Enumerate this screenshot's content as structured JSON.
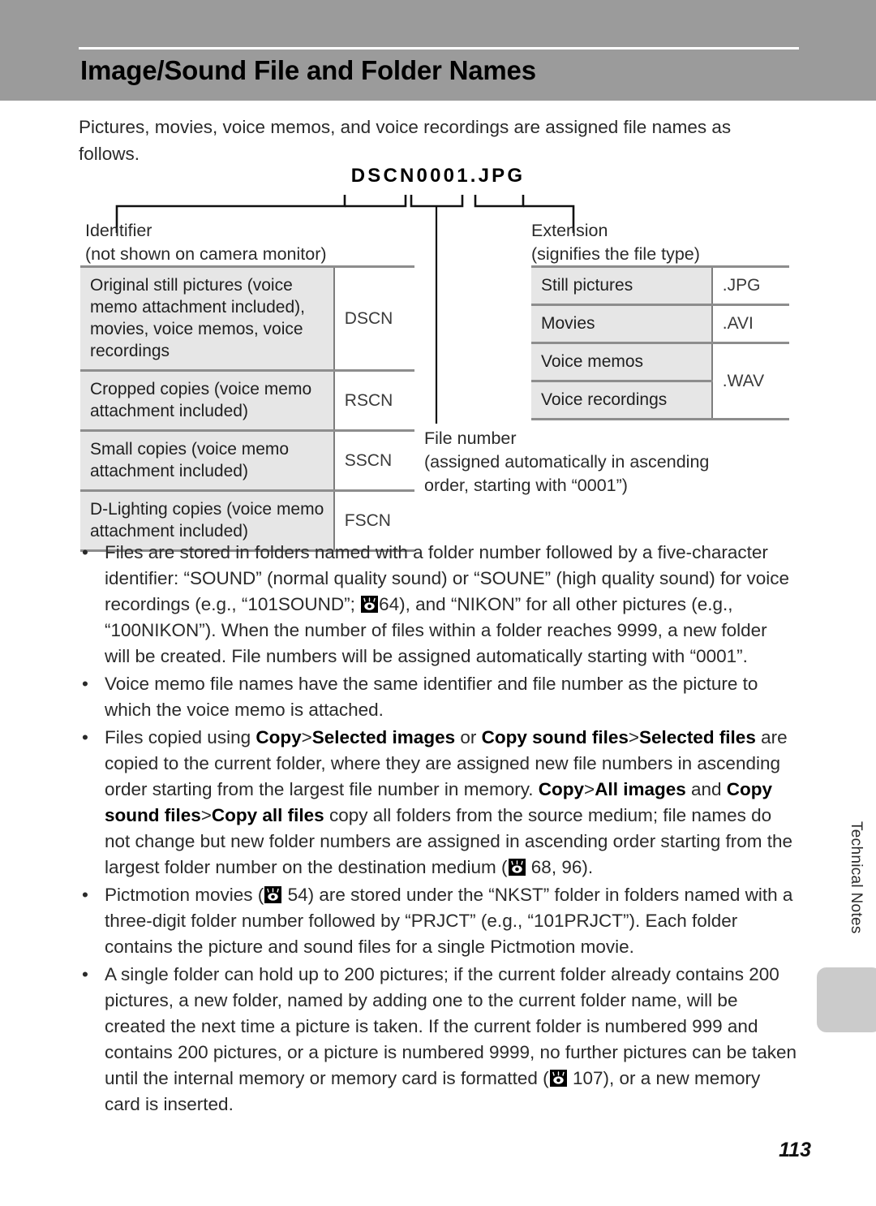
{
  "header": {
    "title": "Image/Sound File and Folder Names"
  },
  "intro": "Pictures, movies, voice memos, and voice recordings are assigned file names as follows.",
  "filename_sample": "DSCN0001.JPG",
  "callouts": {
    "identifier_label": "Identifier",
    "identifier_note": "(not shown on camera monitor)",
    "extension_label": "Extension",
    "extension_note": "(signifies the file type)",
    "filenumber_label": "File number",
    "filenumber_note_line1": "(assigned automatically in ascending",
    "filenumber_note_line2": "order, starting with “0001”)"
  },
  "identifier_table": {
    "rows": [
      {
        "label": "Original still pictures (voice memo attachment included), movies, voice memos, voice recordings",
        "value": "DSCN"
      },
      {
        "label": "Cropped copies (voice memo attachment included)",
        "value": "RSCN"
      },
      {
        "label": "Small copies (voice memo attachment included)",
        "value": "SSCN"
      },
      {
        "label": "D-Lighting copies (voice memo attachment included)",
        "value": "FSCN"
      }
    ]
  },
  "extension_table": {
    "rows": [
      {
        "label": "Still pictures",
        "value": ".JPG"
      },
      {
        "label": "Movies",
        "value": ".AVI"
      },
      {
        "label": "Voice memos",
        "value": ".WAV"
      },
      {
        "label": "Voice recordings",
        "value": ""
      }
    ]
  },
  "bullets": {
    "b1_p1": "Files are stored in folders named with a folder number followed by a five-character identifier: “SOUND” (normal quality sound) or “SOUNE” (high quality sound) for voice recordings (e.g., “101SOUND”; ",
    "b1_ref": "64",
    "b1_p2": "), and “NIKON” for all other pictures (e.g., “100NIKON”). When the number of files within a folder reaches 9999, a new folder will be created. File numbers will be assigned automatically starting with “0001”.",
    "b2": "Voice memo file names have the same identifier and file number as the picture to which the voice memo is attached.",
    "b3_p1": "Files copied using ",
    "b3_b1": "Copy",
    "b3_gt1": ">",
    "b3_b2": "Selected images",
    "b3_p2": " or ",
    "b3_b3": "Copy sound files",
    "b3_gt2": ">",
    "b3_b4": "Selected files",
    "b3_p3": " are copied to the current folder, where they are assigned new file numbers in ascending order starting from the largest file number in memory. ",
    "b3_b5": "Copy",
    "b3_gt3": ">",
    "b3_b6": "All images",
    "b3_p4": " and ",
    "b3_b7": "Copy sound files",
    "b3_gt4": ">",
    "b3_b8": "Copy all files",
    "b3_p5": " copy all folders from the source medium; file names do not change but new folder numbers are assigned in ascending order starting from the largest folder number on the destination medium (",
    "b3_ref": "68, 96",
    "b3_p6": ").",
    "b4_p1": "Pictmotion movies (",
    "b4_ref": "54",
    "b4_p2": ") are stored under the “NKST” folder in folders named with a three-digit folder number followed by “PRJCT” (e.g., “101PRJCT”). Each folder contains the picture and sound files for a single Pictmotion movie.",
    "b5_p1": "A single folder can hold up to 200 pictures; if the current folder already contains 200 pictures, a new folder, named by adding one to the current folder name, will be created the next time a picture is taken. If the current folder is numbered 999 and contains 200 pictures, or a picture is numbered 9999, no further pictures can be taken until the internal memory or memory card is formatted (",
    "b5_ref": "107",
    "b5_p2": "), or a new memory card is inserted.",
    "dot": "•"
  },
  "side": {
    "section_label": "Technical Notes"
  },
  "page_number": "113",
  "colors": {
    "header_band": "#9b9b9b",
    "table_label_bg": "#e6e6e6",
    "table_rule": "#8d8d8d",
    "side_tab": "#cbcbcb"
  }
}
